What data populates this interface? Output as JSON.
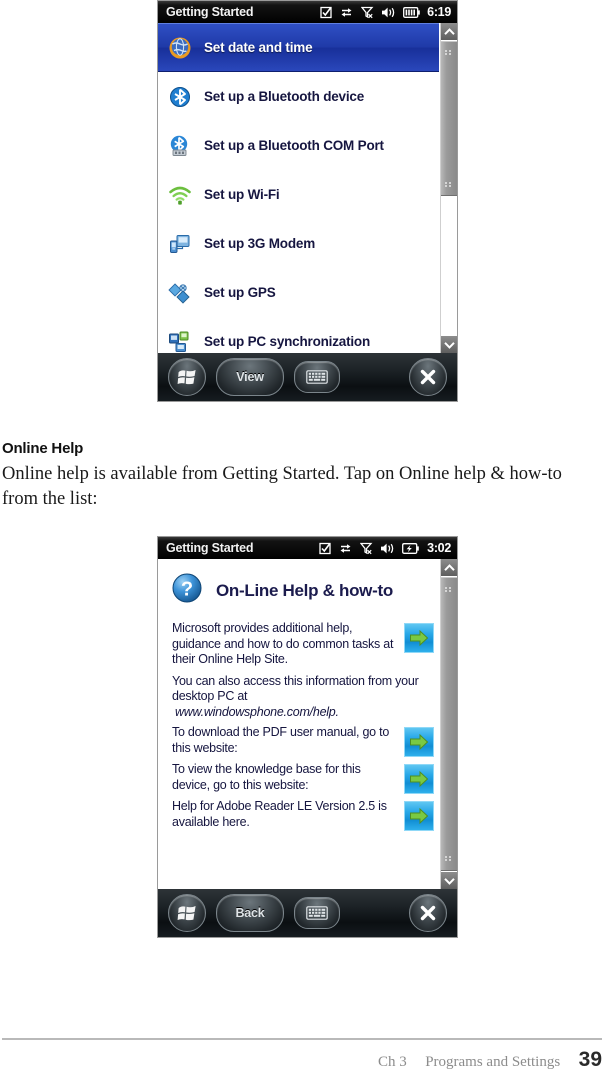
{
  "page": {
    "section_heading": "Online Help",
    "paragraph": "Online help is available from Getting Started. Tap on Online help & how-to from the list:",
    "footer": {
      "chapter": "Ch 3",
      "section": "Programs and Settings",
      "page_number": "39"
    }
  },
  "screenshot_1": {
    "titlebar": {
      "title": "Getting Started",
      "time": "6:19",
      "icons": [
        "note-icon",
        "connectivity-icon",
        "signal-off-icon",
        "volume-icon",
        "battery-icon"
      ]
    },
    "list": [
      {
        "label": "Set date and time",
        "icon": "clock-globe-icon",
        "selected": true
      },
      {
        "label": "Set up a Bluetooth device",
        "icon": "bluetooth-icon",
        "selected": false
      },
      {
        "label": "Set up a Bluetooth COM Port",
        "icon": "bluetooth-com-port-icon",
        "selected": false
      },
      {
        "label": "Set up Wi-Fi",
        "icon": "wifi-icon",
        "selected": false
      },
      {
        "label": "Set up 3G Modem",
        "icon": "modem-icon",
        "selected": false
      },
      {
        "label": "Set up GPS",
        "icon": "gps-icon",
        "selected": false
      },
      {
        "label": "Set up PC synchronization",
        "icon": "pc-sync-icon",
        "selected": false
      }
    ],
    "toolbar": {
      "start_label": "start-icon",
      "soft_key": "View",
      "keyboard_label": "keyboard-icon",
      "close_label": "close-icon"
    }
  },
  "screenshot_2": {
    "titlebar": {
      "title": "Getting Started",
      "time": "3:02",
      "icons": [
        "note-icon",
        "connectivity-icon",
        "signal-off-icon",
        "volume-icon",
        "battery-charging-icon"
      ]
    },
    "heading": "On-Line Help & how-to",
    "heading_icon": "question-mark-icon",
    "blocks": [
      {
        "text": "Microsoft provides additional help, guidance and how to do common tasks at their Online Help Site.",
        "arrow": true,
        "italic": false
      },
      {
        "text": "You can also access this information from your desktop PC at",
        "arrow": false,
        "italic": false
      },
      {
        "text": "www.windowsphone.com/help.",
        "arrow": false,
        "italic": true
      },
      {
        "text": "To download the PDF user manual, go to this website:",
        "arrow": true,
        "italic": false
      },
      {
        "text": "To view the knowledge base for this device, go to this website:",
        "arrow": true,
        "italic": false
      },
      {
        "text": "Help for Adobe Reader LE Version 2.5 is available here.",
        "arrow": true,
        "italic": false
      }
    ],
    "toolbar": {
      "start_label": "start-icon",
      "soft_key": "Back",
      "keyboard_label": "keyboard-icon",
      "close_label": "close-icon"
    }
  },
  "colors": {
    "selection_blue": "#1f3aa8",
    "titlebar_black": "#000000",
    "arrow_button_blue": "#29a8e8",
    "arrow_green": "#7ac943",
    "footer_gray": "#8c8c8c"
  }
}
